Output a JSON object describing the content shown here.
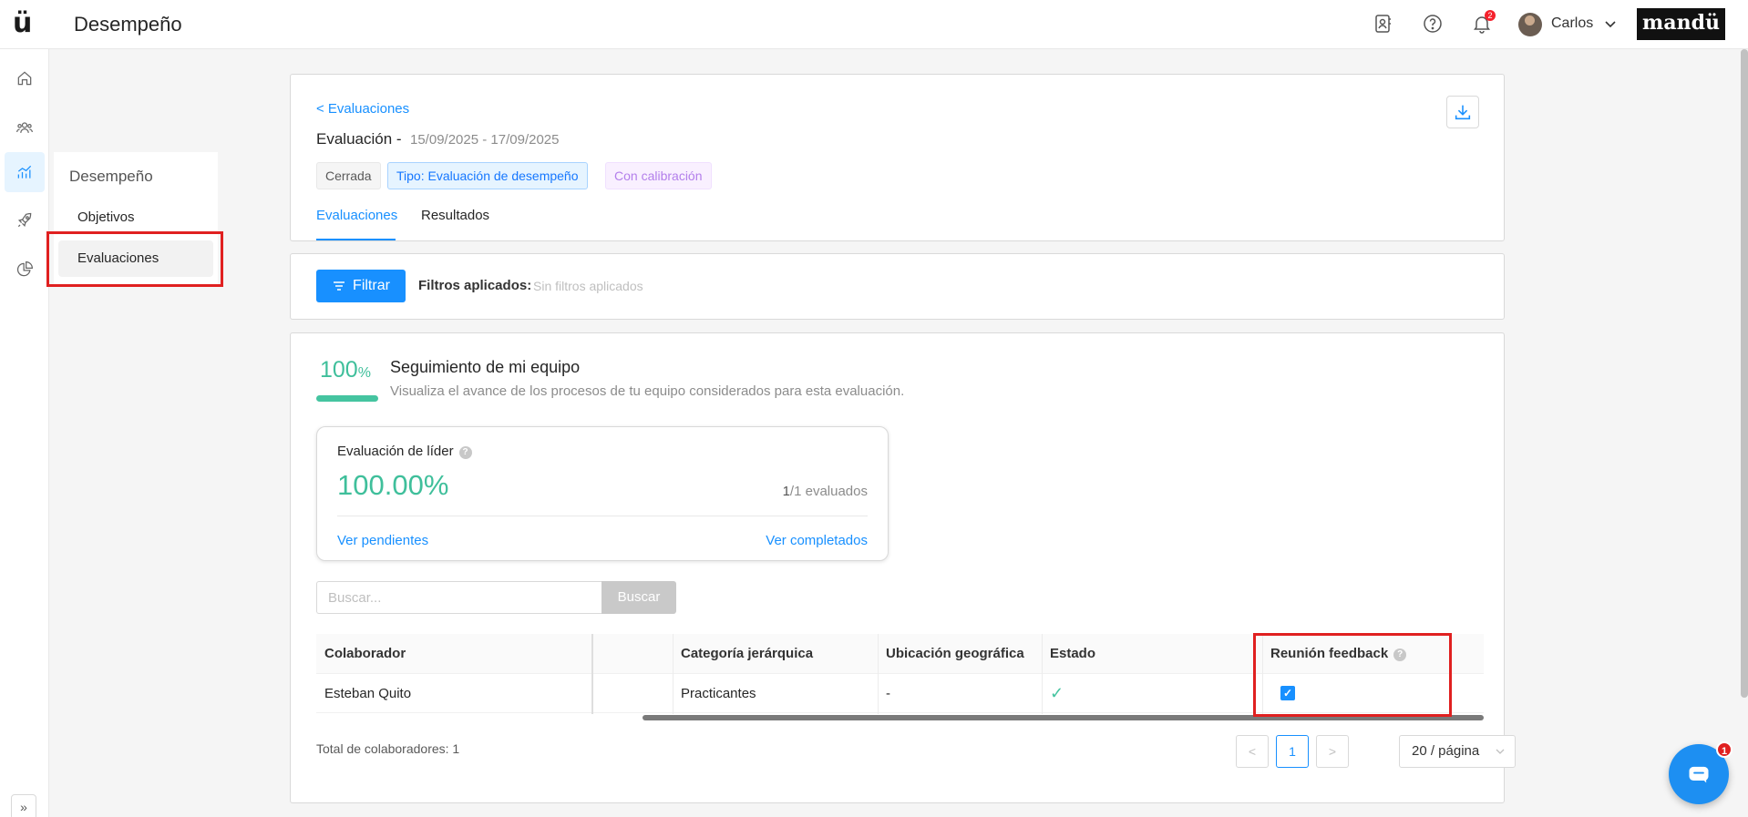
{
  "app": {
    "logo": "ü",
    "page_title": "Desempeño",
    "brand": "mandü",
    "user_name": "Carlos",
    "notification_count": "2",
    "chat_badge": "1"
  },
  "rail": {
    "icons": [
      "home-icon",
      "team-icon",
      "performance-chart-icon",
      "rocket-icon",
      "pie-chart-icon"
    ],
    "expand_label": "»"
  },
  "submenu": {
    "title": "Desempeño",
    "items": [
      {
        "label": "Objetivos"
      },
      {
        "label": "Evaluaciones"
      }
    ]
  },
  "header": {
    "back_link": "< Evaluaciones",
    "title": "Evaluación -",
    "dates": "15/09/2025 - 17/09/2025",
    "tags": {
      "status": "Cerrada",
      "type": "Tipo: Evaluación de desempeño",
      "calibration": "Con calibración"
    },
    "tabs": [
      {
        "label": "Evaluaciones"
      },
      {
        "label": "Resultados"
      }
    ]
  },
  "filters": {
    "button_label": "Filtrar",
    "applied_label": "Filtros aplicados:",
    "applied_value": "Sin filtros aplicados"
  },
  "tracking": {
    "percent": "100",
    "percent_sign": "%",
    "progress": 1.0,
    "title": "Seguimiento de mi equipo",
    "subtitle": "Visualiza el avance de los procesos de tu equipo considerados para esta evaluación.",
    "leader": {
      "title": "Evaluación de líder",
      "percent": "100.00%",
      "count_done": "1",
      "count_rest": "/1 evaluados",
      "pending_link": "Ver pendientes",
      "completed_link": "Ver completados"
    }
  },
  "search": {
    "placeholder": "Buscar...",
    "button_label": "Buscar"
  },
  "table": {
    "columns": {
      "collaborator": "Colaborador",
      "category": "Categoría jerárquica",
      "location": "Ubicación geográfica",
      "status": "Estado",
      "feedback": "Reunión feedback"
    },
    "rows": [
      {
        "collaborator": "Esteban Quito",
        "category": "Practicantes",
        "location": "-",
        "status": "✓",
        "feedback_checked": true
      }
    ]
  },
  "pagination": {
    "total_label": "Total de colaboradores: 1",
    "prev": "<",
    "current_page": "1",
    "next": ">",
    "page_size": "20 / página"
  },
  "colors": {
    "primary": "#1890ff",
    "success": "#3fbf9b",
    "highlight": "#e02020"
  }
}
